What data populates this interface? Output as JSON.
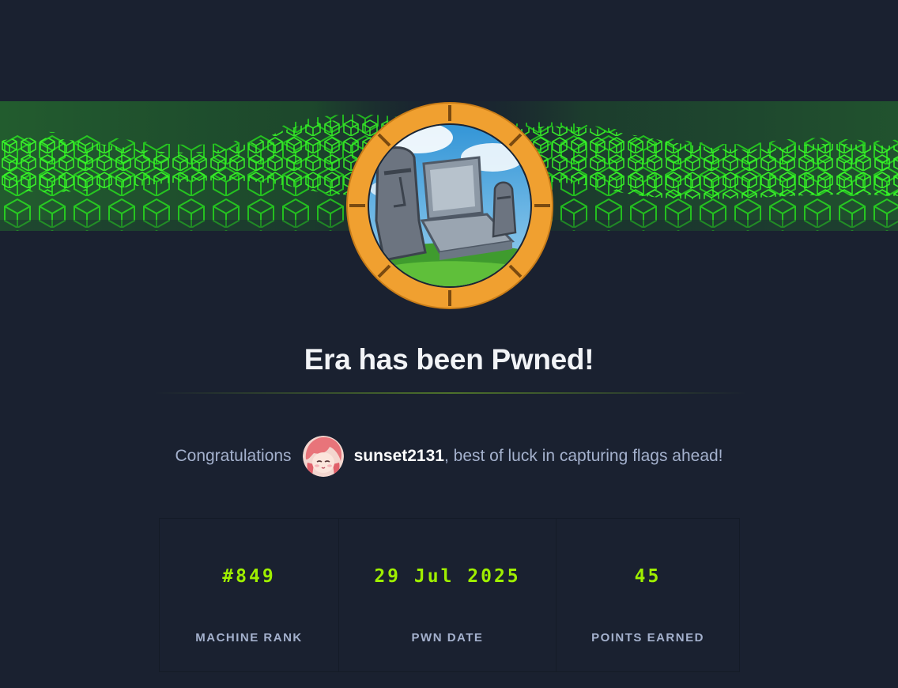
{
  "page": {
    "machine_name": "Era",
    "title": "Era has been Pwned!",
    "congrats_prefix": "Congratulations",
    "username": "sunset2131",
    "congrats_suffix": ", best of luck in capturing flags ahead!"
  },
  "stats": [
    {
      "value": "#849",
      "label": "MACHINE RANK"
    },
    {
      "value": "29 Jul 2025",
      "label": "PWN DATE"
    },
    {
      "value": "45",
      "label": "POINTS EARNED"
    }
  ],
  "colors": {
    "background": "#1a2130",
    "accent_green": "#9fef00",
    "badge_ring": "#f0a030",
    "muted_text": "#a4b1cd"
  },
  "icons": {
    "banner": "green-cube-wave-banner",
    "machine": "era-machine-badge",
    "avatar": "user-avatar"
  }
}
